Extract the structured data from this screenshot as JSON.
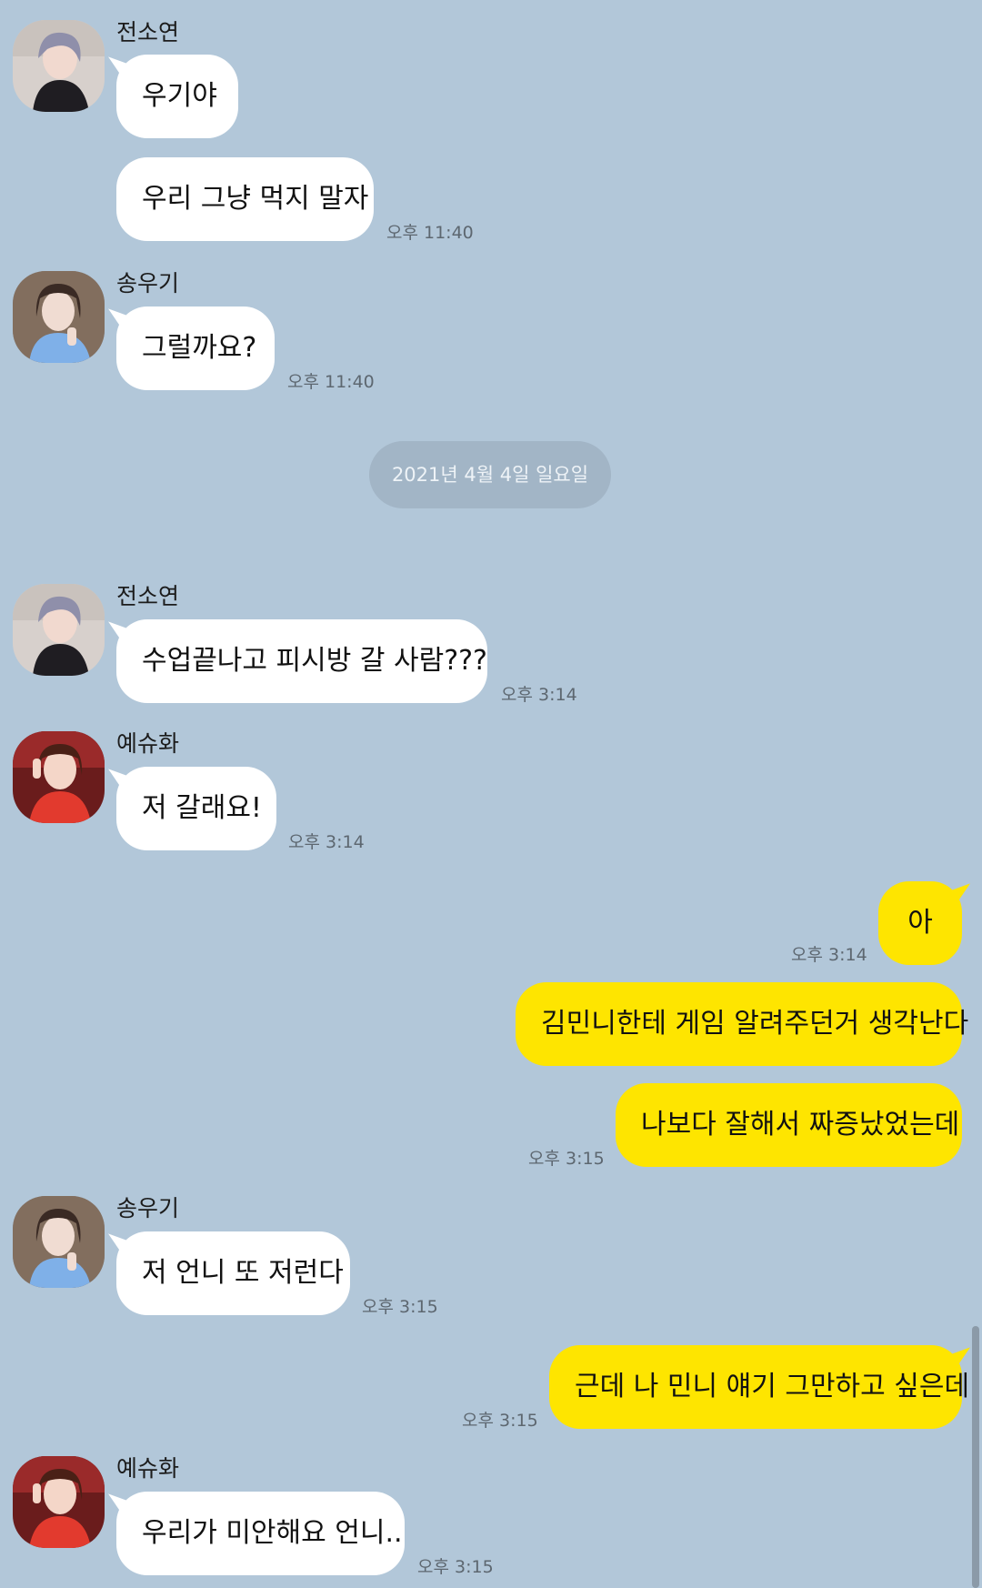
{
  "chat": {
    "date_divider": "2021년 4월 4일 일요일",
    "messages": [
      {
        "sender": "전소연",
        "text": "우기야",
        "time": ""
      },
      {
        "sender": "",
        "text": "우리 그냥 먹지 말자",
        "time": "오후 11:40"
      },
      {
        "sender": "송우기",
        "text": "그럴까요?",
        "time": "오후 11:40"
      },
      {
        "sender": "전소연",
        "text": "수업끝나고 피시방 갈 사람???",
        "time": "오후 3:14"
      },
      {
        "sender": "예슈화",
        "text": "저 갈래요!",
        "time": "오후 3:14"
      },
      {
        "sender": "me",
        "text": "아",
        "time": "오후 3:14"
      },
      {
        "sender": "me",
        "text": "김민니한테 게임 알려주던거 생각난다",
        "time": ""
      },
      {
        "sender": "me",
        "text": "나보다 잘해서 짜증났었는데",
        "time": "오후 3:15"
      },
      {
        "sender": "송우기",
        "text": "저 언니 또 저런다",
        "time": "오후 3:15"
      },
      {
        "sender": "me",
        "text": "근데 나 민니 얘기 그만하고 싶은데",
        "time": "오후 3:15"
      },
      {
        "sender": "예슈화",
        "text": "우리가 미안해요 언니..",
        "time": "오후 3:15"
      }
    ]
  },
  "colors": {
    "background": "#b2c7d9",
    "incoming_bubble": "#ffffff",
    "outgoing_bubble": "#fee500",
    "date_pill": "#a2b5c6"
  },
  "icons": {
    "avatar_jeon_soyeon": "profile-photo",
    "avatar_song_yuqi": "profile-photo",
    "avatar_ye_shuhua": "profile-photo"
  }
}
